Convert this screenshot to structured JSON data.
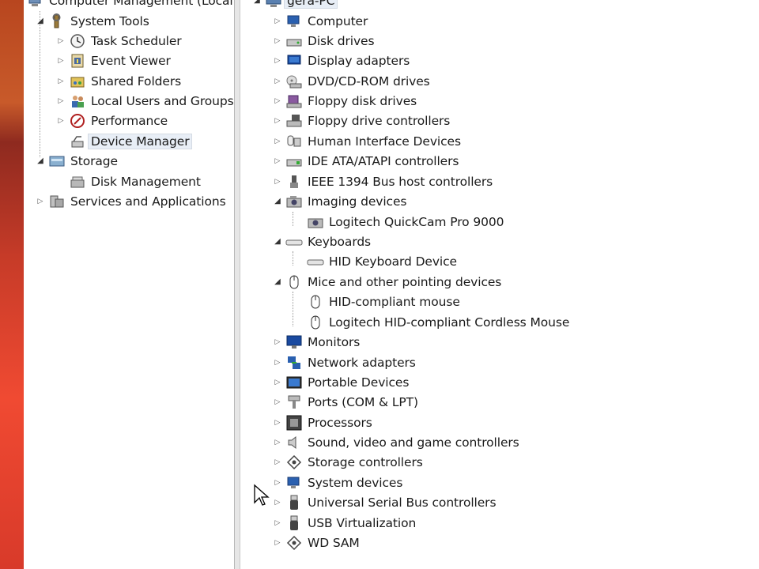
{
  "left_tree": {
    "root": {
      "label": "Computer Management (Local"
    },
    "items": [
      {
        "label": "System Tools"
      },
      {
        "label": "Task Scheduler"
      },
      {
        "label": "Event Viewer"
      },
      {
        "label": "Shared Folders"
      },
      {
        "label": "Local Users and Groups"
      },
      {
        "label": "Performance"
      },
      {
        "label": "Device Manager"
      },
      {
        "label": "Storage"
      },
      {
        "label": "Disk Management"
      },
      {
        "label": "Services and Applications"
      }
    ]
  },
  "right_tree": {
    "root": {
      "label": "gera-PC"
    },
    "items": [
      {
        "label": "Computer"
      },
      {
        "label": "Disk drives"
      },
      {
        "label": "Display adapters"
      },
      {
        "label": "DVD/CD-ROM drives"
      },
      {
        "label": "Floppy disk drives"
      },
      {
        "label": "Floppy drive controllers"
      },
      {
        "label": "Human Interface Devices"
      },
      {
        "label": "IDE ATA/ATAPI controllers"
      },
      {
        "label": "IEEE 1394 Bus host controllers"
      },
      {
        "label": "Imaging devices"
      },
      {
        "label": "Logitech QuickCam Pro 9000"
      },
      {
        "label": "Keyboards"
      },
      {
        "label": "HID Keyboard Device"
      },
      {
        "label": "Mice and other pointing devices"
      },
      {
        "label": "HID-compliant mouse"
      },
      {
        "label": "Logitech HID-compliant Cordless Mouse"
      },
      {
        "label": "Monitors"
      },
      {
        "label": "Network adapters"
      },
      {
        "label": "Portable Devices"
      },
      {
        "label": "Ports (COM & LPT)"
      },
      {
        "label": "Processors"
      },
      {
        "label": "Sound, video and game controllers"
      },
      {
        "label": "Storage controllers"
      },
      {
        "label": "System devices"
      },
      {
        "label": "Universal Serial Bus controllers"
      },
      {
        "label": "USB Virtualization"
      },
      {
        "label": "WD SAM"
      }
    ]
  },
  "icons": {
    "collapsed": "▷",
    "expanded": "◢"
  }
}
